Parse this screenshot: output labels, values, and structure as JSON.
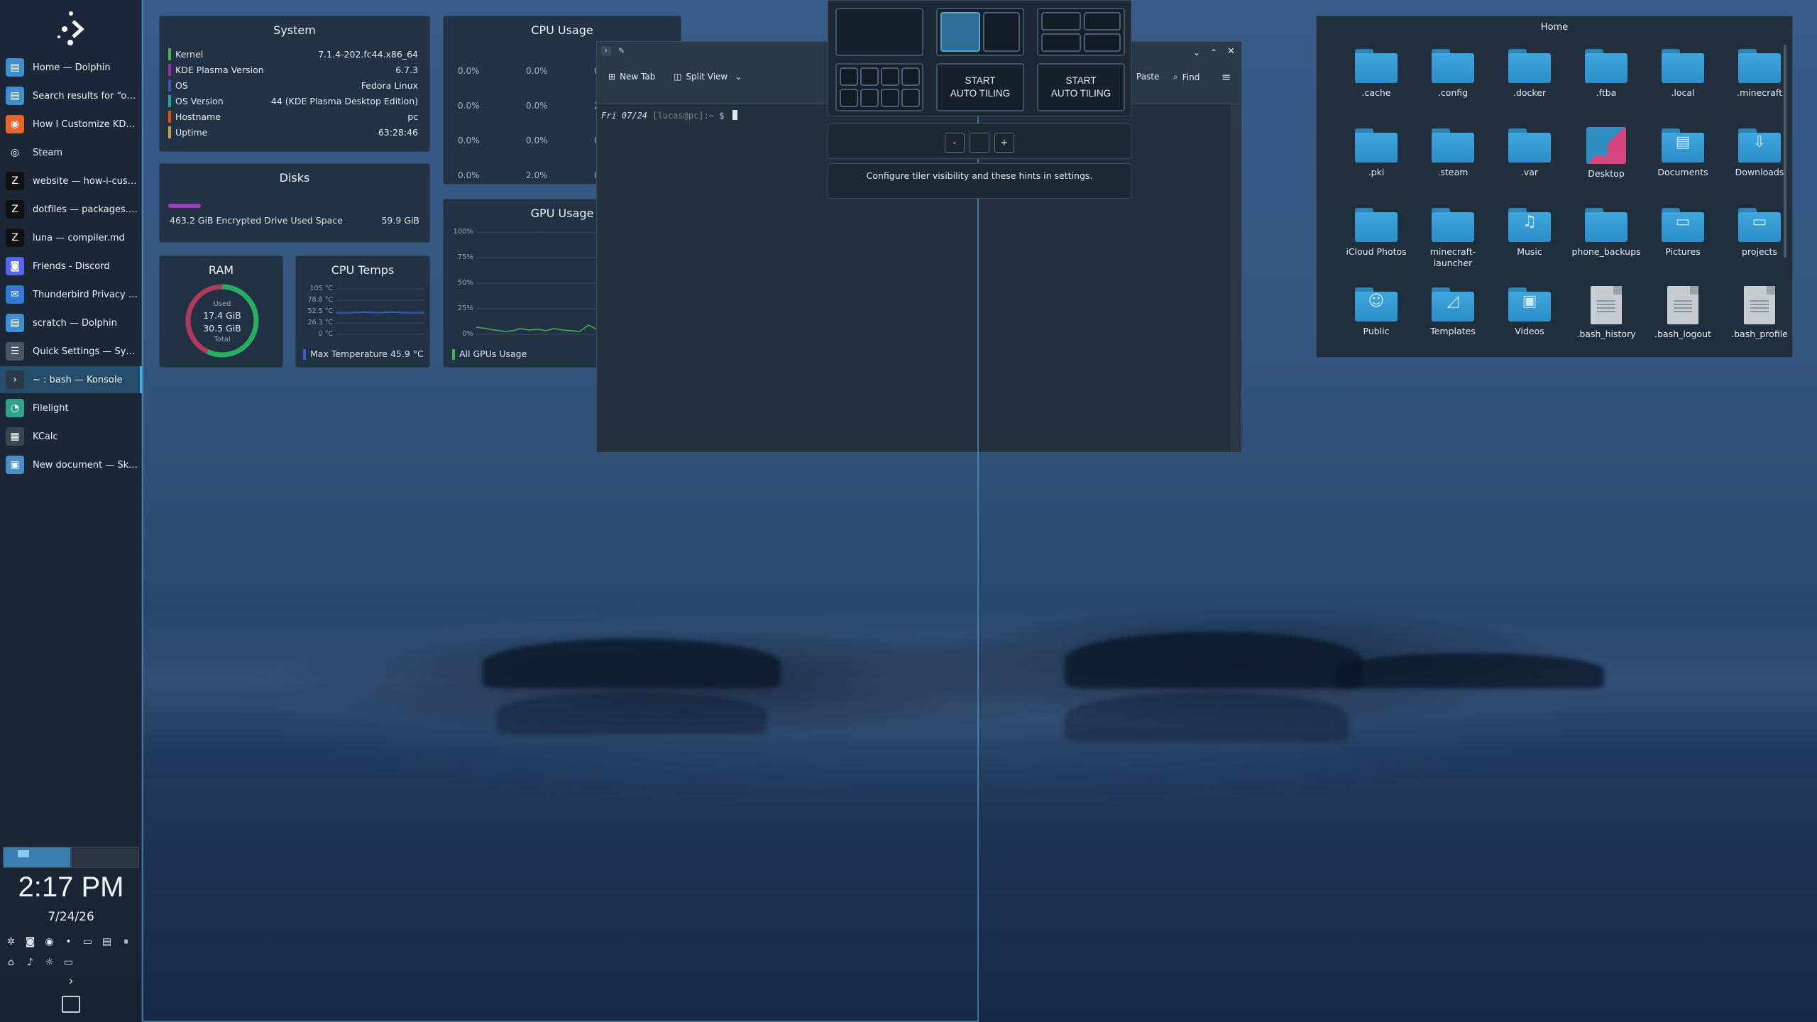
{
  "taskbar": {
    "tasks": [
      {
        "label": "Home — Dolphin",
        "icon": "dolphin-icon",
        "color": "#3d8fd1"
      },
      {
        "label": "Search results for “opti...",
        "icon": "dolphin-icon",
        "color": "#3d8fd1"
      },
      {
        "label": "How I Customize KDE ...",
        "icon": "firefox-icon",
        "color": "#e8662a"
      },
      {
        "label": "Steam",
        "icon": "steam-icon",
        "color": "#1b2838"
      },
      {
        "label": "website — how-i-custo...",
        "icon": "zed-icon",
        "color": "#111111"
      },
      {
        "label": "dotfiles — packages.txt",
        "icon": "zed-icon",
        "color": "#111111"
      },
      {
        "label": "luna — compiler.md",
        "icon": "zed-icon",
        "color": "#111111"
      },
      {
        "label": "Friends - Discord",
        "icon": "discord-icon",
        "color": "#5865f2"
      },
      {
        "label": "Thunderbird Privacy N...",
        "icon": "thunderbird-icon",
        "color": "#2f7bd6"
      },
      {
        "label": "scratch — Dolphin",
        "icon": "dolphin-icon",
        "color": "#3d8fd1"
      },
      {
        "label": "Quick Settings — Syste...",
        "icon": "settings-icon",
        "color": "#4a5866"
      },
      {
        "label": "~ : bash — Konsole",
        "icon": "konsole-icon",
        "color": "#2b3a48"
      },
      {
        "label": "Filelight",
        "icon": "filelight-icon",
        "color": "#2ea38a"
      },
      {
        "label": "KCalc",
        "icon": "calculator-icon",
        "color": "#3a4654"
      },
      {
        "label": "New document — Ska...",
        "icon": "skanpage-icon",
        "color": "#4a90c8"
      }
    ],
    "clock_time": "2:17 PM",
    "clock_date": "7/24/26",
    "tray_icons_row1": [
      "bug-icon",
      "discord-icon",
      "steam-icon",
      "dot-icon",
      "terminal-icon",
      "clipboard-icon",
      "pause-icon"
    ],
    "tray_icons_row2": [
      "network-icon",
      "volume-icon",
      "brightness-icon",
      "display-icon"
    ],
    "expand_glyph": "›"
  },
  "system": {
    "title": "System",
    "rows": [
      {
        "key": "Kernel",
        "value": "7.1.4-202.fc44.x86_64",
        "color": "#4caf50"
      },
      {
        "key": "KDE Plasma Version",
        "value": "6.7.3",
        "color": "#9c27b0"
      },
      {
        "key": "OS",
        "value": "Fedora Linux",
        "color": "#3f51b5"
      },
      {
        "key": "OS Version",
        "value": "44 (KDE Plasma Desktop Edition)",
        "color": "#26a69a"
      },
      {
        "key": "Hostname",
        "value": "pc",
        "color": "#e65100"
      },
      {
        "key": "Uptime",
        "value": "63:28:46",
        "color": "#c0a24a"
      }
    ]
  },
  "disks": {
    "title": "Disks",
    "label": "463.2 GiB Encrypted Drive Used Space",
    "value": "59.9 GiB",
    "fill_fraction": 0.13,
    "color": "#9c3fbf"
  },
  "cpu_usage": {
    "title": "CPU Usage",
    "rows": [
      [
        "0.0%",
        "0.0%",
        "0.0"
      ],
      [
        "0.0%",
        "0.0%",
        "2.0"
      ],
      [
        "0.0%",
        "0.0%",
        "0.0"
      ],
      [
        "0.0%",
        "2.0%",
        "0.0"
      ]
    ]
  },
  "gpu_usage": {
    "title": "GPU Usage",
    "ticks": [
      "100%",
      "75%",
      "50%",
      "25%",
      "0%"
    ],
    "legend": "All GPUs Usage",
    "line_color": "#4caf50"
  },
  "ram": {
    "title": "RAM",
    "used_label": "Used",
    "used": "17.4 GiB",
    "total": "30.5 GiB",
    "total_label": "Total",
    "fill_fraction": 0.57,
    "color_used": "#27ae60",
    "color_free": "#b03a5b"
  },
  "cpu_temps": {
    "title": "CPU Temps",
    "ticks": [
      "105 °C",
      "78.8 °C",
      "52.5 °C",
      "26.3 °C",
      "0 °C"
    ],
    "legend": "Max Temperature 45.9 °C",
    "line_color": "#3b5fc6"
  },
  "konsole": {
    "new_tab": "New Tab",
    "split_view": "Split View",
    "paste": "Paste",
    "find": "Find",
    "prompt_date": "Fri 07/24",
    "prompt_user": "[lucas@pc]:~",
    "prompt_symbol": "$"
  },
  "tiler": {
    "start_auto_tiling_1": "START\nAUTO TILING",
    "start_auto_tiling_2": "START\nAUTO TILING",
    "decrease": "-",
    "increase": "+",
    "hint": "Configure tiler visibility and these hints in settings."
  },
  "dolphin": {
    "title": "Home",
    "items": [
      {
        "name": ".cache",
        "kind": "folder"
      },
      {
        "name": ".config",
        "kind": "folder"
      },
      {
        "name": ".docker",
        "kind": "folder"
      },
      {
        "name": ".ftba",
        "kind": "folder"
      },
      {
        "name": ".local",
        "kind": "folder"
      },
      {
        "name": ".minecraft",
        "kind": "folder"
      },
      {
        "name": ".pki",
        "kind": "folder"
      },
      {
        "name": ".steam",
        "kind": "folder"
      },
      {
        "name": ".var",
        "kind": "folder"
      },
      {
        "name": "Desktop",
        "kind": "desktop"
      },
      {
        "name": "Documents",
        "kind": "folder",
        "glyph": "▤"
      },
      {
        "name": "Downloads",
        "kind": "folder",
        "glyph": "⇩"
      },
      {
        "name": "iCloud Photos",
        "kind": "folder"
      },
      {
        "name": "minecraft-launcher",
        "kind": "folder"
      },
      {
        "name": "Music",
        "kind": "folder",
        "glyph": "♫"
      },
      {
        "name": "phone_backups",
        "kind": "folder"
      },
      {
        "name": "Pictures",
        "kind": "folder",
        "glyph": "▭"
      },
      {
        "name": "projects",
        "kind": "folder",
        "glyph": "▭"
      },
      {
        "name": "Public",
        "kind": "folder",
        "glyph": "☺"
      },
      {
        "name": "Templates",
        "kind": "folder",
        "glyph": "◿"
      },
      {
        "name": "Videos",
        "kind": "folder",
        "glyph": "▣"
      },
      {
        "name": ".bash_history",
        "kind": "file"
      },
      {
        "name": ".bash_logout",
        "kind": "file"
      },
      {
        "name": ".bash_profile",
        "kind": "file"
      }
    ]
  }
}
